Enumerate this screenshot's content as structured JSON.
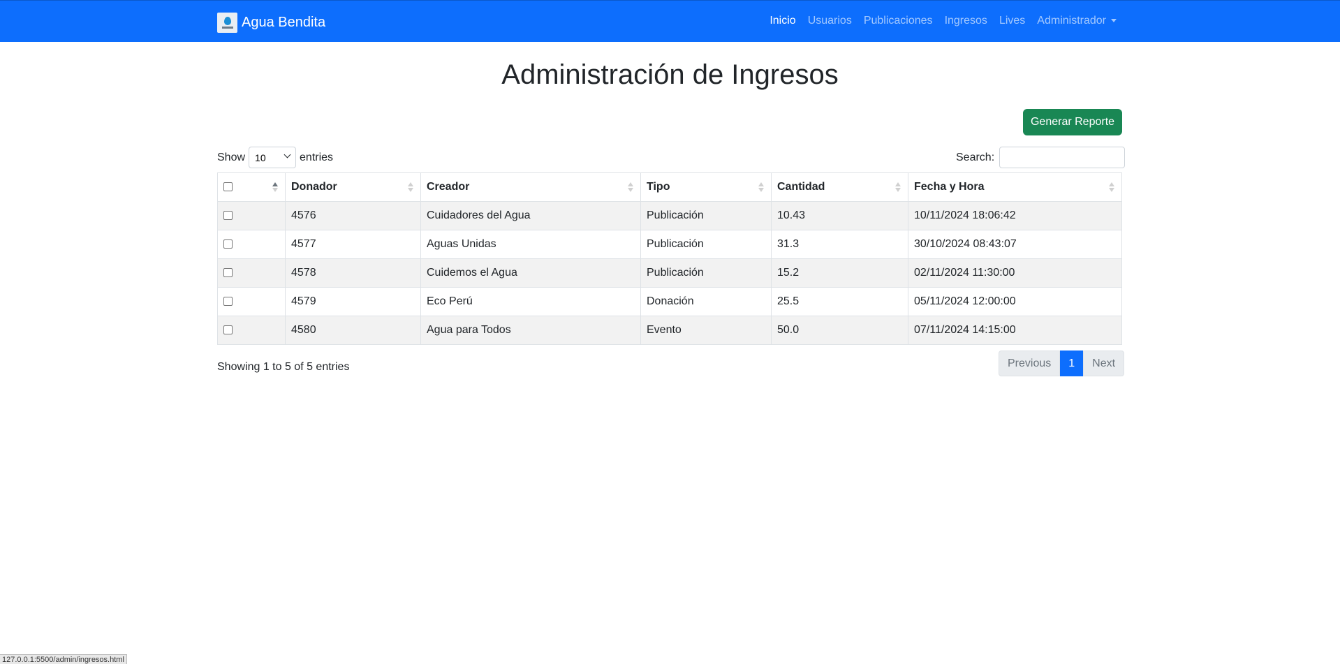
{
  "navbar": {
    "brand": "Agua Bendita",
    "items": [
      {
        "label": "Inicio",
        "active": true
      },
      {
        "label": "Usuarios"
      },
      {
        "label": "Publicaciones"
      },
      {
        "label": "Ingresos"
      },
      {
        "label": "Lives"
      },
      {
        "label": "Administrador",
        "dropdown": true
      }
    ],
    "color": "#0d6efd"
  },
  "page": {
    "title": "Administración de Ingresos",
    "report_button": "Generar Reporte"
  },
  "controls": {
    "show_label": "Show",
    "entries_label": "entries",
    "page_length": "10",
    "search_label": "Search:",
    "search_value": ""
  },
  "table": {
    "columns": [
      "",
      "Donador",
      "Creador",
      "Tipo",
      "Cantidad",
      "Fecha y Hora"
    ],
    "rows": [
      {
        "donador": "4576",
        "creador": "Cuidadores del Agua",
        "tipo": "Publicación",
        "cantidad": "10.43",
        "fecha": "10/11/2024 18:06:42"
      },
      {
        "donador": "4577",
        "creador": "Aguas Unidas",
        "tipo": "Publicación",
        "cantidad": "31.3",
        "fecha": "30/10/2024 08:43:07"
      },
      {
        "donador": "4578",
        "creador": "Cuidemos el Agua",
        "tipo": "Publicación",
        "cantidad": "15.2",
        "fecha": "02/11/2024 11:30:00"
      },
      {
        "donador": "4579",
        "creador": "Eco Perú",
        "tipo": "Donación",
        "cantidad": "25.5",
        "fecha": "05/11/2024 12:00:00"
      },
      {
        "donador": "4580",
        "creador": "Agua para Todos",
        "tipo": "Evento",
        "cantidad": "50.0",
        "fecha": "07/11/2024 14:15:00"
      }
    ]
  },
  "footer": {
    "info": "Showing 1 to 5 of 5 entries",
    "previous": "Previous",
    "current_page": "1",
    "next": "Next"
  },
  "status_url": "127.0.0.1:5500/admin/ingresos.html",
  "colors": {
    "primary": "#0d6efd",
    "success": "#198754"
  }
}
